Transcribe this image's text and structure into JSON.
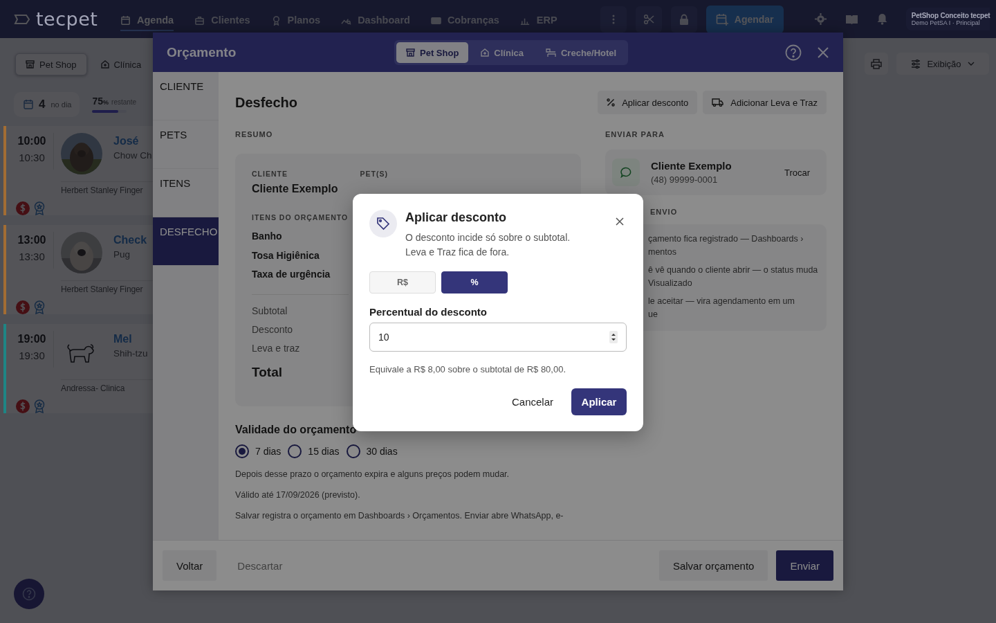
{
  "navbar": {
    "logo": "tecpet",
    "items": [
      {
        "label": "Agenda",
        "selected": true
      },
      {
        "label": "Clientes",
        "selected": false
      },
      {
        "label": "Planos",
        "selected": false
      },
      {
        "label": "Dashboard",
        "selected": false
      },
      {
        "label": "Cobranças",
        "selected": false
      },
      {
        "label": "ERP",
        "selected": false
      }
    ],
    "action": "Agendar",
    "account": {
      "name": "PetShop Conceito tecpet",
      "unit": "Demo PetSA I · Principal"
    }
  },
  "background": {
    "segments": [
      {
        "label": "Pet Shop",
        "selected": true
      },
      {
        "label": "Clínica",
        "selected": false
      }
    ],
    "day_count": {
      "value": "4",
      "label": "no dia"
    },
    "capacity": {
      "value": "75",
      "unit": "%",
      "label": "restante",
      "level": 0.75
    },
    "appointments": [
      {
        "start": "10:00",
        "end": "10:30",
        "name": "José",
        "breed": "Chow Ch",
        "owner": "Herbert Stanley Finger",
        "color": "#a36d33"
      },
      {
        "start": "13:00",
        "end": "13:30",
        "name": "Check",
        "breed": "Pug",
        "owner": "Herbert Stanley Finger",
        "color": "#a36d33"
      },
      {
        "start": "19:00",
        "end": "19:30",
        "name": "Mel",
        "breed": "Shih-tzu",
        "owner": "Andressa- Clinica",
        "color": "#1e8585",
        "kind": "drawing"
      }
    ],
    "display_button": "Exibição"
  },
  "panel": {
    "title": "Orçamento",
    "tabs": [
      {
        "label": "Pet Shop",
        "selected": true
      },
      {
        "label": "Clínica",
        "selected": false
      },
      {
        "label": "Creche/Hotel",
        "selected": false
      }
    ],
    "steps": [
      {
        "label": "CLIENTE",
        "selected": false
      },
      {
        "label": "PETS",
        "selected": false
      },
      {
        "label": "ITENS",
        "selected": false
      },
      {
        "label": "DESFECHO",
        "selected": true
      }
    ],
    "section_title": "Desfecho",
    "actions": [
      "Aplicar desconto",
      "Adicionar Leva e Traz"
    ],
    "summary": {
      "heading": "RESUMO",
      "client_label": "CLIENTE",
      "client": "Cliente Exemplo",
      "pets_label": "PET(S)",
      "items_label": "ITENS DO ORÇAMENTO",
      "items": [
        "Banho",
        "Tosa Higiênica",
        "Taxa de urgência"
      ],
      "totals": [
        "Subtotal",
        "Desconto",
        "Leva e traz"
      ],
      "total_label": "Total"
    },
    "send": {
      "heading": "ENVIAR PARA",
      "contact": "Cliente Exemplo",
      "phone": "(48) 99999-0001",
      "change": "Trocar",
      "how_heading": "ENVIO",
      "notes": [
        [
          "çamento fica registrado — Dashboards ›",
          "mentos"
        ],
        [
          "ê vê quando o cliente abrir — o status muda",
          "Visualizado"
        ],
        [
          "le aceitar — vira agendamento em um",
          "ue"
        ]
      ]
    },
    "validity": {
      "title": "Validade do orçamento",
      "options": [
        {
          "label": "7 dias",
          "selected": true
        },
        {
          "label": "15 dias",
          "selected": false
        },
        {
          "label": "30 dias",
          "selected": false
        }
      ],
      "notes": [
        "Depois desse prazo o orçamento expira e alguns preços podem mudar.",
        "Válido até 17/09/2026 (previsto).",
        "Salvar registra o orçamento em Dashboards › Orçamentos. Enviar abre WhatsApp, e-"
      ]
    },
    "footer": {
      "back": "Voltar",
      "discard": "Descartar",
      "save": "Salvar orçamento",
      "send": "Enviar"
    }
  },
  "dialog": {
    "title": "Aplicar desconto",
    "description": [
      "O desconto incide só sobre o subtotal.",
      "Leva e Traz fica de fora."
    ],
    "modes": [
      {
        "label": "R$",
        "selected": false
      },
      {
        "label": "%",
        "selected": true
      }
    ],
    "field_label": "Percentual do desconto",
    "value": "10",
    "hint": "Equivale a R$ 8,00 sobre o subtotal de R$ 80,00.",
    "cancel": "Cancelar",
    "apply": "Aplicar"
  }
}
